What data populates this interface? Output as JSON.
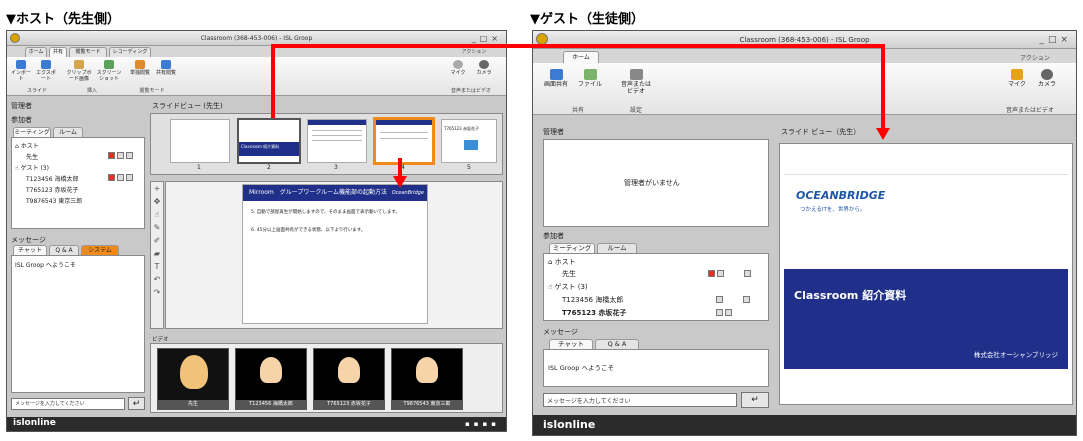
{
  "captions": {
    "host": "▼ホスト（先生側）",
    "guest": "▼ゲスト（生徒側）"
  },
  "host": {
    "title": "Classroom (368-453-006) - ISL Groop",
    "tabs": [
      "ホーム",
      "共有",
      "閲覧モード",
      "レコーディング"
    ],
    "toolbar": {
      "import": "インポート",
      "export": "エクスポート",
      "clipboard": "クリップボード画像",
      "screenshot": "スクリーンショット",
      "single_view": "単独閲覧",
      "shared_view": "共有閲覧",
      "action": "アクション",
      "mic": "マイク",
      "camera": "カメラ",
      "group_slide": "スライド",
      "group_insert": "挿入",
      "group_view": "閲覧モード",
      "group_av": "音声またはビデオ"
    },
    "admin_title": "管理者",
    "participants_title": "参加者",
    "participant_tabs": [
      "ミーティング",
      "ルーム"
    ],
    "host_label": "ホスト",
    "teacher": "先生",
    "guest_label": "ゲスト (3)",
    "guests": [
      "T123456 海橋太郎",
      "T765123 赤坂花子",
      "T9876543 東京三郎"
    ],
    "slide_view_title": "スライドビュー (先生)",
    "thumbnails": [
      {
        "num": "1",
        "text": ""
      },
      {
        "num": "2",
        "text": "Classroom 紹介資料"
      },
      {
        "num": "3",
        "text": ""
      },
      {
        "num": "4",
        "text": ""
      },
      {
        "num": "5",
        "text": "T765123 赤坂花子"
      }
    ],
    "slide": {
      "header": "Mirroom　グループワークルーム機能部の起動方法",
      "brand": "OceanBridge",
      "line1": "5.  自動で部屋再生が開始しますので、そのまま画面で表示動いてします。",
      "line2": "6.  45分以上画面共有ができる状態、以下より行います。"
    },
    "video_title": "ビデオ",
    "videos": [
      "先生",
      "T123456 海橋太郎",
      "T765123 赤坂花子",
      "T9876543 東京三郎"
    ],
    "message_title": "メッセージ",
    "message_tabs": [
      "チャット",
      "Q & A",
      "システム"
    ],
    "welcome": "ISL Groop へようこそ",
    "input_placeholder": "メッセージを入力してください",
    "send": "↵",
    "status_brand": "islonline"
  },
  "guest": {
    "title": "Classroom (368-453-006) - ISL Groop",
    "tab_home": "ホーム",
    "toolbar": {
      "screen_share": "画面共有",
      "file": "ファイル",
      "av": "音声または ビデオ",
      "action": "アクション",
      "mic": "マイク",
      "camera": "カメラ",
      "group_share": "共有",
      "group_settings": "設定",
      "group_av": "音声またはビデオ"
    },
    "admin_title": "管理者",
    "admin_empty": "管理者がいません",
    "participants_title": "参加者",
    "participant_tabs": [
      "ミーティング",
      "ルーム"
    ],
    "host_label": "ホスト",
    "teacher": "先生",
    "guest_label": "ゲスト (3)",
    "guests": [
      "T123456 海橋太郎",
      "T765123 赤坂花子"
    ],
    "slide_view_title": "スライド ビュー（先生）",
    "slide": {
      "brand": "OCEANBRIDGE",
      "tagline": "つかえるITを、世界から。",
      "title": "Classroom 紹介資料",
      "company": "株式会社オーシャンブリッジ"
    },
    "message_title": "メッセージ",
    "message_tabs": [
      "チャット",
      "Q & A"
    ],
    "welcome": "ISL Groop へようこそ",
    "input_placeholder": "メッセージを入力してください",
    "send": "↵",
    "status_brand": "islonline"
  },
  "colors": {
    "accent": "#ff0000",
    "slide_blue": "#1f2f8a",
    "status_bar": "#2b2b2b"
  }
}
